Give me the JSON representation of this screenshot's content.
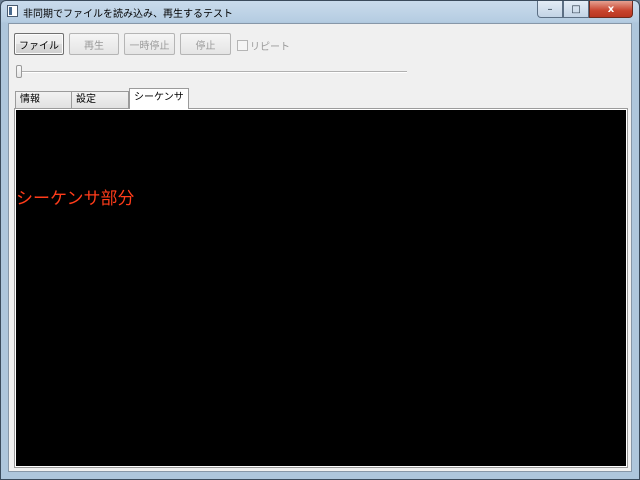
{
  "window": {
    "title": "非同期でファイルを読み込み、再生するテスト",
    "caption_buttons": {
      "minimize_icon": "minimize-icon",
      "maximize_icon": "maximize-icon",
      "close_icon": "close-icon",
      "minimize_glyph": "–",
      "maximize_glyph": "□",
      "close_glyph": "x"
    }
  },
  "toolbar": {
    "file_label": "ファイル",
    "play_label": "再生",
    "pause_label": "一時停止",
    "stop_label": "停止",
    "repeat_label": "リピート",
    "repeat_checked": false
  },
  "seek_slider": {
    "position": 0
  },
  "tabs": [
    {
      "label": "情報",
      "active": false
    },
    {
      "label": "設定",
      "active": false
    },
    {
      "label": "シーケンサ",
      "active": true
    }
  ],
  "sequencer_panel": {
    "text": "シーケンサ部分",
    "text_color": "#ff3c1a",
    "background": "#000000"
  }
}
